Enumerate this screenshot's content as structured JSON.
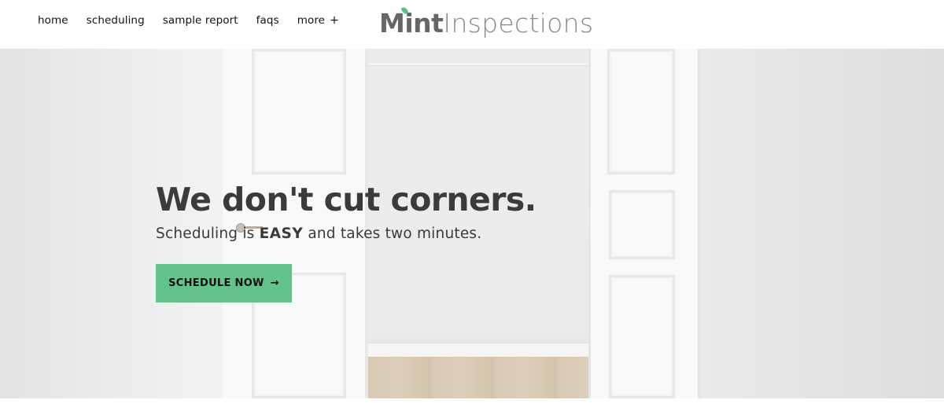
{
  "nav": {
    "items": [
      {
        "label": "home"
      },
      {
        "label": "scheduling"
      },
      {
        "label": "sample report"
      },
      {
        "label": "faqs"
      },
      {
        "label": "more"
      }
    ],
    "more_icon": "+"
  },
  "logo": {
    "part1": "Mint",
    "part2": "Inspections",
    "accent_color": "#5bbf85"
  },
  "hero": {
    "title": "We don't cut corners.",
    "subtitle_pre": "Scheduling is ",
    "subtitle_emphasis": "EASY",
    "subtitle_post": " and takes two minutes.",
    "cta_label": "SCHEDULE NOW",
    "cta_icon": "→",
    "cta_color": "#64c28c"
  }
}
